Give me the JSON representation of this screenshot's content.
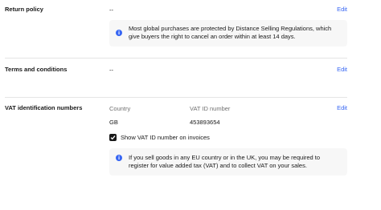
{
  "return_policy": {
    "title": "Return policy",
    "value": "--",
    "edit_label": "Edit",
    "info_text": "Most global purchases are protected by Distance Selling Regulations, which give buyers the right to cancel an order within at least 14 days.",
    "info_icon": "info-icon"
  },
  "terms": {
    "title": "Terms and conditions",
    "value": "--",
    "edit_label": "Edit"
  },
  "vat": {
    "title": "VAT identification numbers",
    "edit_label": "Edit",
    "country_header": "Country",
    "vat_header": "VAT ID number",
    "country_value": "GB",
    "vat_value": "453893654",
    "show_on_invoices_label": "Show VAT ID number on invoices",
    "show_on_invoices_checked": true,
    "info_text": "If you sell goods in any EU country or in the UK, you may be required to register for value added tax (VAT) and to collect VAT on your sales.",
    "info_icon": "info-icon"
  },
  "colors": {
    "accent": "#3665f3",
    "text": "#191919",
    "muted": "#707070",
    "info_bg": "#f7f7f7",
    "divider": "#e5e5e5"
  }
}
